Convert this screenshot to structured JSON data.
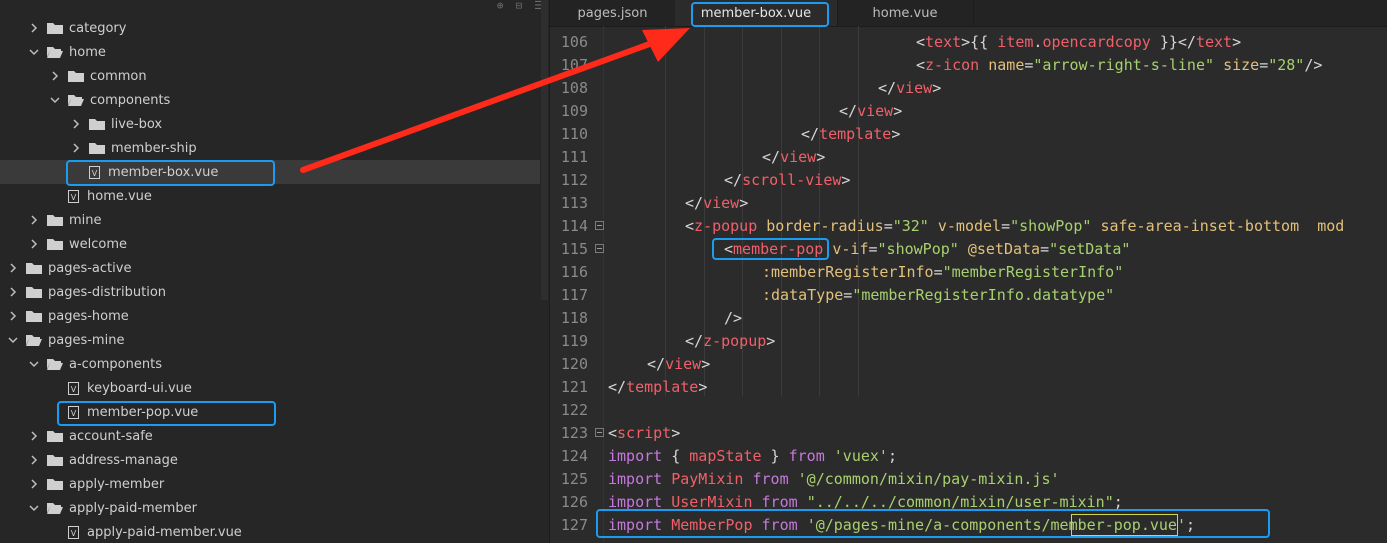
{
  "sidebar": {
    "toolbar_icons": [
      "locate-icon",
      "collapse-icon",
      "menu-icon"
    ],
    "items": [
      {
        "label": "category",
        "type": "folder",
        "expanded": false,
        "depth": 1
      },
      {
        "label": "home",
        "type": "folder",
        "expanded": true,
        "depth": 1
      },
      {
        "label": "common",
        "type": "folder",
        "expanded": false,
        "depth": 2
      },
      {
        "label": "components",
        "type": "folder",
        "expanded": true,
        "depth": 2
      },
      {
        "label": "live-box",
        "type": "folder",
        "expanded": false,
        "depth": 3
      },
      {
        "label": "member-ship",
        "type": "folder",
        "expanded": false,
        "depth": 3
      },
      {
        "label": "member-box.vue",
        "type": "file",
        "depth": 3,
        "selected": true
      },
      {
        "label": "home.vue",
        "type": "file",
        "depth": 2
      },
      {
        "label": "mine",
        "type": "folder",
        "expanded": false,
        "depth": 1
      },
      {
        "label": "welcome",
        "type": "folder",
        "expanded": false,
        "depth": 1
      },
      {
        "label": "pages-active",
        "type": "folder",
        "expanded": false,
        "depth": 0
      },
      {
        "label": "pages-distribution",
        "type": "folder",
        "expanded": false,
        "depth": 0
      },
      {
        "label": "pages-home",
        "type": "folder",
        "expanded": false,
        "depth": 0
      },
      {
        "label": "pages-mine",
        "type": "folder",
        "expanded": true,
        "depth": 0
      },
      {
        "label": "a-components",
        "type": "folder",
        "expanded": true,
        "depth": 1
      },
      {
        "label": "keyboard-ui.vue",
        "type": "file",
        "depth": 2
      },
      {
        "label": "member-pop.vue",
        "type": "file",
        "depth": 2
      },
      {
        "label": "account-safe",
        "type": "folder",
        "expanded": false,
        "depth": 1
      },
      {
        "label": "address-manage",
        "type": "folder",
        "expanded": false,
        "depth": 1
      },
      {
        "label": "apply-member",
        "type": "folder",
        "expanded": false,
        "depth": 1
      },
      {
        "label": "apply-paid-member",
        "type": "folder",
        "expanded": true,
        "depth": 1
      },
      {
        "label": "apply-paid-member.vue",
        "type": "file",
        "depth": 2
      }
    ]
  },
  "tabs": [
    {
      "label": "pages.json",
      "active": false
    },
    {
      "label": "member-box.vue",
      "active": true
    },
    {
      "label": "home.vue",
      "active": false
    }
  ],
  "editor": {
    "lines": [
      {
        "n": "106",
        "fold": false,
        "tokens": [
          [
            "punc",
            "<"
          ],
          [
            "tag",
            "text"
          ],
          [
            "punc",
            ">{{ "
          ],
          [
            "var",
            "item"
          ],
          [
            "punc",
            "."
          ],
          [
            "var",
            "opencardcopy"
          ],
          [
            "punc",
            " }}</"
          ],
          [
            "tag",
            "text"
          ],
          [
            "punc",
            ">"
          ]
        ],
        "indent": 308
      },
      {
        "n": "107",
        "fold": false,
        "tokens": [
          [
            "punc",
            "<"
          ],
          [
            "tag",
            "z-icon"
          ],
          [
            "punc",
            " "
          ],
          [
            "attr",
            "name"
          ],
          [
            "punc",
            "="
          ],
          [
            "str",
            "\"arrow-right-s-line\""
          ],
          [
            "punc",
            " "
          ],
          [
            "attr",
            "size"
          ],
          [
            "punc",
            "="
          ],
          [
            "str",
            "\"28\""
          ],
          [
            "punc",
            "/>"
          ]
        ],
        "indent": 308
      },
      {
        "n": "108",
        "fold": false,
        "tokens": [
          [
            "punc",
            "</"
          ],
          [
            "tag",
            "view"
          ],
          [
            "punc",
            ">"
          ]
        ],
        "indent": 270
      },
      {
        "n": "109",
        "fold": false,
        "tokens": [
          [
            "punc",
            "</"
          ],
          [
            "tag",
            "view"
          ],
          [
            "punc",
            ">"
          ]
        ],
        "indent": 231
      },
      {
        "n": "110",
        "fold": false,
        "tokens": [
          [
            "punc",
            "</"
          ],
          [
            "tag",
            "template"
          ],
          [
            "punc",
            ">"
          ]
        ],
        "indent": 193
      },
      {
        "n": "111",
        "fold": false,
        "tokens": [
          [
            "punc",
            "</"
          ],
          [
            "tag",
            "view"
          ],
          [
            "punc",
            ">"
          ]
        ],
        "indent": 154
      },
      {
        "n": "112",
        "fold": false,
        "tokens": [
          [
            "punc",
            "</"
          ],
          [
            "tag",
            "scroll-view"
          ],
          [
            "punc",
            ">"
          ]
        ],
        "indent": 116
      },
      {
        "n": "113",
        "fold": false,
        "tokens": [
          [
            "punc",
            "</"
          ],
          [
            "tag",
            "view"
          ],
          [
            "punc",
            ">"
          ]
        ],
        "indent": 77
      },
      {
        "n": "114",
        "fold": true,
        "tokens": [
          [
            "punc",
            "<"
          ],
          [
            "tag",
            "z-popup"
          ],
          [
            "punc",
            " "
          ],
          [
            "attr",
            "border-radius"
          ],
          [
            "punc",
            "="
          ],
          [
            "str",
            "\"32\""
          ],
          [
            "punc",
            " "
          ],
          [
            "attr",
            "v-model"
          ],
          [
            "punc",
            "="
          ],
          [
            "str",
            "\"showPop\""
          ],
          [
            "punc",
            " "
          ],
          [
            "attr",
            "safe-area-inset-bottom"
          ],
          [
            "punc",
            "  "
          ],
          [
            "attr",
            "mod"
          ]
        ],
        "indent": 77
      },
      {
        "n": "115",
        "fold": true,
        "tokens": [
          [
            "punc",
            "<"
          ],
          [
            "tag",
            "member-pop"
          ],
          [
            "punc",
            " "
          ],
          [
            "attr",
            "v-if"
          ],
          [
            "punc",
            "="
          ],
          [
            "str",
            "\"showPop\""
          ],
          [
            "punc",
            " "
          ],
          [
            "attr",
            "@setData"
          ],
          [
            "punc",
            "="
          ],
          [
            "str",
            "\"setData\""
          ]
        ],
        "indent": 116
      },
      {
        "n": "116",
        "fold": false,
        "tokens": [
          [
            "attr",
            ":memberRegisterInfo"
          ],
          [
            "punc",
            "="
          ],
          [
            "str",
            "\"memberRegisterInfo\""
          ]
        ],
        "indent": 154
      },
      {
        "n": "117",
        "fold": false,
        "tokens": [
          [
            "attr",
            ":dataType"
          ],
          [
            "punc",
            "="
          ],
          [
            "str",
            "\"memberRegisterInfo.datatype\""
          ]
        ],
        "indent": 154
      },
      {
        "n": "118",
        "fold": false,
        "tokens": [
          [
            "punc",
            "/>"
          ]
        ],
        "indent": 116
      },
      {
        "n": "119",
        "fold": false,
        "tokens": [
          [
            "punc",
            "</"
          ],
          [
            "tag",
            "z-popup"
          ],
          [
            "punc",
            ">"
          ]
        ],
        "indent": 77
      },
      {
        "n": "120",
        "fold": false,
        "tokens": [
          [
            "punc",
            "</"
          ],
          [
            "tag",
            "view"
          ],
          [
            "punc",
            ">"
          ]
        ],
        "indent": 39
      },
      {
        "n": "121",
        "fold": false,
        "tokens": [
          [
            "punc",
            "</"
          ],
          [
            "tag",
            "template"
          ],
          [
            "punc",
            ">"
          ]
        ],
        "indent": 0
      },
      {
        "n": "122",
        "fold": false,
        "tokens": [],
        "indent": 0
      },
      {
        "n": "123",
        "fold": true,
        "tokens": [
          [
            "punc",
            "<"
          ],
          [
            "tag",
            "script"
          ],
          [
            "punc",
            ">"
          ]
        ],
        "indent": 0
      },
      {
        "n": "124",
        "fold": false,
        "tokens": [
          [
            "kw",
            "import"
          ],
          [
            "punc",
            " { "
          ],
          [
            "var",
            "mapState"
          ],
          [
            "punc",
            " } "
          ],
          [
            "kw",
            "from"
          ],
          [
            "punc",
            " "
          ],
          [
            "str",
            "'vuex'"
          ],
          [
            "punc",
            ";"
          ]
        ],
        "indent": 0
      },
      {
        "n": "125",
        "fold": false,
        "tokens": [
          [
            "kw",
            "import"
          ],
          [
            "punc",
            " "
          ],
          [
            "var",
            "PayMixin"
          ],
          [
            "punc",
            " "
          ],
          [
            "kw",
            "from"
          ],
          [
            "punc",
            " "
          ],
          [
            "str",
            "'@/common/mixin/pay-mixin.js'"
          ]
        ],
        "indent": 0
      },
      {
        "n": "126",
        "fold": false,
        "tokens": [
          [
            "kw",
            "import"
          ],
          [
            "punc",
            " "
          ],
          [
            "var",
            "UserMixin"
          ],
          [
            "punc",
            " "
          ],
          [
            "kw",
            "from"
          ],
          [
            "punc",
            " "
          ],
          [
            "str",
            "\"../../../common/mixin/user-mixin\""
          ],
          [
            "punc",
            ";"
          ]
        ],
        "indent": 0
      },
      {
        "n": "127",
        "fold": false,
        "tokens": [
          [
            "kw",
            "import"
          ],
          [
            "punc",
            " "
          ],
          [
            "var",
            "MemberPop"
          ],
          [
            "punc",
            " "
          ],
          [
            "kw",
            "from"
          ],
          [
            "punc",
            " "
          ],
          [
            "str",
            "'@/pages-mine/a-components/member-pop.vue'"
          ],
          [
            "punc",
            ";"
          ]
        ],
        "indent": 0
      }
    ]
  },
  "colors": {
    "highlight": "#1a9cf0",
    "arrow": "#ff2a1a",
    "tag": "#f0606a",
    "attr": "#e1c07a",
    "string": "#a7d16e",
    "keyword": "#c678dd"
  }
}
